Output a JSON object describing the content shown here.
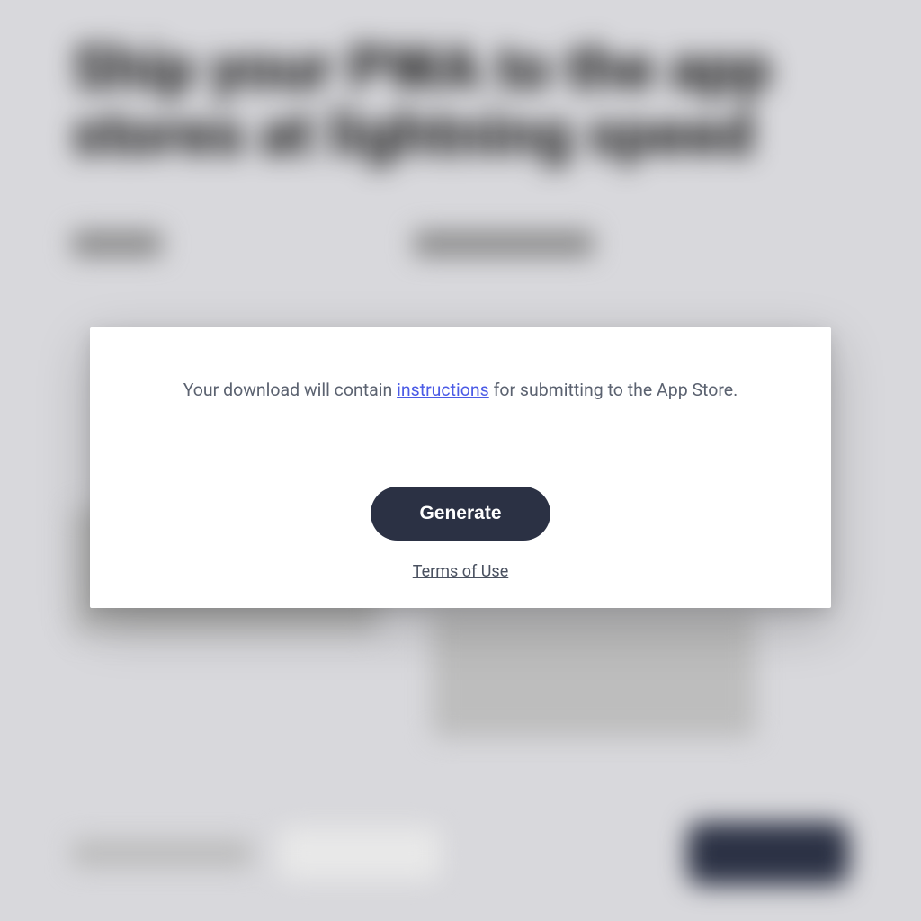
{
  "background": {
    "heading": "Ship your PWA to the app stores at lightning speed"
  },
  "modal": {
    "message_prefix": "Your download will contain ",
    "link_text": "instructions",
    "message_suffix": " for submitting to the App Store.",
    "generate_label": "Generate",
    "terms_label": "Terms of Use"
  }
}
